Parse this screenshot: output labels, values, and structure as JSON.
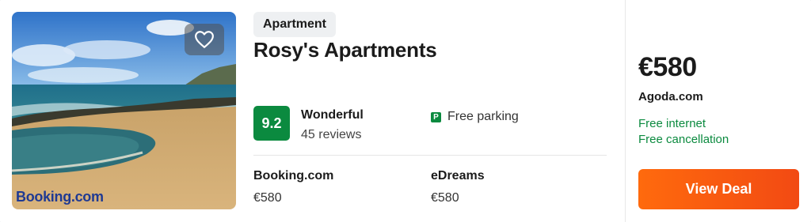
{
  "listing": {
    "type_badge": "Apartment",
    "name": "Rosy's Apartments",
    "photo_source": "Booking.com",
    "rating": {
      "score": "9.2",
      "label": "Wonderful",
      "reviews": "45 reviews"
    },
    "amenities": [
      {
        "icon": "parking-icon",
        "glyph": "P",
        "label": "Free parking"
      }
    ],
    "other_providers": [
      {
        "name": "Booking.com",
        "price": "€580"
      },
      {
        "name": "eDreams",
        "price": "€580"
      }
    ]
  },
  "deal": {
    "price": "€580",
    "provider": "Agoda.com",
    "perks": [
      "Free internet",
      "Free cancellation"
    ],
    "button_label": "View Deal"
  },
  "colors": {
    "score_green": "#0b8a3f",
    "perk_green": "#0b8a3f",
    "cta_orange": "#ff6a0d"
  }
}
